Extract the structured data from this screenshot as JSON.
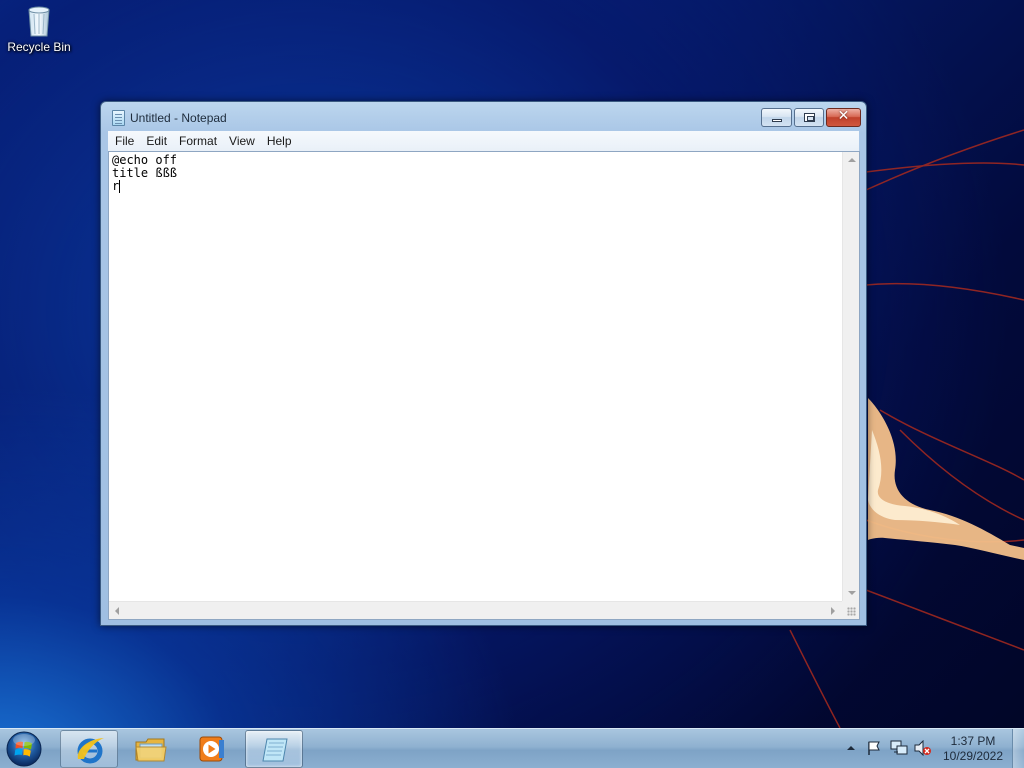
{
  "desktop": {
    "icons": [
      {
        "label": "Recycle Bin",
        "icon": "recycle-bin-icon"
      }
    ]
  },
  "window": {
    "title": "Untitled - Notepad",
    "app_icon": "notepad-icon",
    "menu": [
      "File",
      "Edit",
      "Format",
      "View",
      "Help"
    ],
    "content_lines": [
      "@echo off",
      "title ßßß",
      "r"
    ],
    "caption_buttons": [
      "minimize",
      "maximize",
      "close"
    ]
  },
  "taskbar": {
    "start_icon": "windows-orb-icon",
    "items": [
      {
        "name": "Internet Explorer",
        "icon": "internet-explorer-icon",
        "state": "pinned"
      },
      {
        "name": "Windows Explorer",
        "icon": "folder-icon",
        "state": "pinned"
      },
      {
        "name": "Windows Media Player",
        "icon": "media-player-icon",
        "state": "pinned"
      },
      {
        "name": "Notepad",
        "icon": "notepad-icon",
        "state": "running"
      }
    ],
    "tray": {
      "icons": [
        "show-hidden-icons-chevron",
        "action-center-flag-icon",
        "network-icon",
        "volume-muted-icon"
      ],
      "time": "1:37 PM",
      "date": "10/29/2022"
    }
  },
  "colors": {
    "desktop_blue": "#051c6e",
    "titlebar": "#bcd6ee",
    "close_button": "#c0412b",
    "taskbar": "#8fb1d0"
  }
}
